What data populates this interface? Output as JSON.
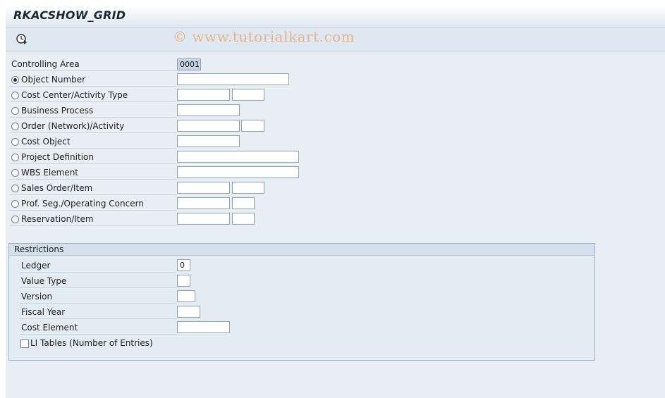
{
  "title": "RKACSHOW_GRID",
  "watermark": "© www.tutorialkart.com",
  "toolbar": {
    "execute_icon": "execute-clock-icon"
  },
  "controlling_area": {
    "label": "Controlling Area",
    "value": "0001"
  },
  "objects": [
    {
      "label": "Object Number",
      "selected": true
    },
    {
      "label": "Cost Center/Activity Type",
      "selected": false
    },
    {
      "label": "Business Process",
      "selected": false
    },
    {
      "label": "Order (Network)/Activity",
      "selected": false
    },
    {
      "label": "Cost Object",
      "selected": false
    },
    {
      "label": "Project Definition",
      "selected": false
    },
    {
      "label": "WBS Element",
      "selected": false
    },
    {
      "label": "Sales Order/Item",
      "selected": false
    },
    {
      "label": "Prof. Seg./Operating Concern",
      "selected": false
    },
    {
      "label": "Reservation/Item",
      "selected": false
    }
  ],
  "restrictions": {
    "title": "Restrictions",
    "ledger": {
      "label": "Ledger",
      "value": "0"
    },
    "value_type": {
      "label": "Value Type",
      "value": ""
    },
    "version": {
      "label": "Version",
      "value": ""
    },
    "fiscal_year": {
      "label": "Fiscal Year",
      "value": ""
    },
    "cost_element": {
      "label": "Cost Element",
      "value": ""
    },
    "li_tables": {
      "label": "LI Tables (Number of Entries)",
      "checked": false
    }
  }
}
